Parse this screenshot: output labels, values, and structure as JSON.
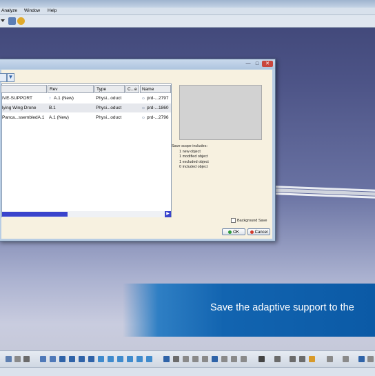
{
  "menu": [
    "Analyze",
    "Window",
    "Help"
  ],
  "dialog": {
    "columns": [
      "Rev",
      "Type",
      "C...e",
      "Name"
    ],
    "rows": [
      {
        "item": "IVE-SUPPORT",
        "rev": "A.1 (New)",
        "type": "Physi...oduct",
        "name": "prd-...2797"
      },
      {
        "item": "lying Wing Drone",
        "rev": "B.1",
        "type": "Physi...oduct",
        "name": "prd-...1860"
      },
      {
        "item": "Panca...ssembledA.1",
        "rev": "A.1 (New)",
        "type": "Physi...oduct",
        "name": "prd-...2796"
      }
    ],
    "scope": {
      "lead": "Save scope includes:",
      "lines": [
        "1   new object",
        "1   modified object",
        "1   excluded object",
        "0   included object"
      ]
    },
    "background_save_label": "Background Save",
    "ok_label": "OK",
    "cancel_label": "Cancel"
  },
  "caption": "Save the adaptive support to the",
  "colors": {
    "banner": "#0b5aa6",
    "scroll_accent": "#3a44cc",
    "background_top": "#3d4475"
  }
}
